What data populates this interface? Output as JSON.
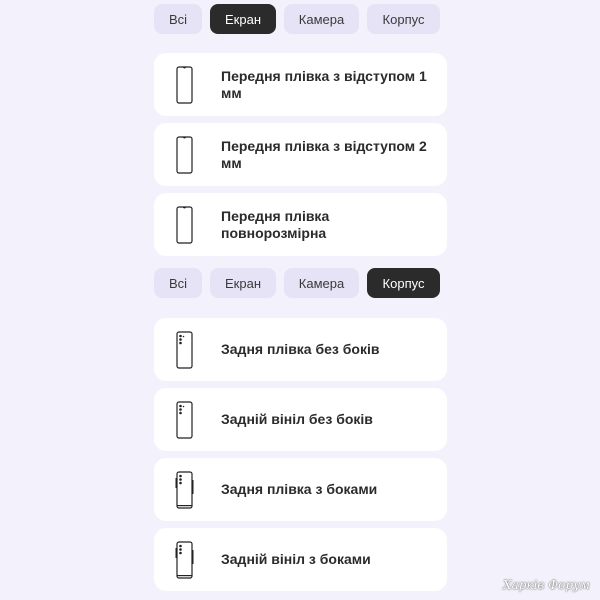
{
  "tabs_top": [
    {
      "label": "Всі",
      "active": false
    },
    {
      "label": "Екран",
      "active": true
    },
    {
      "label": "Камера",
      "active": false
    },
    {
      "label": "Корпус",
      "active": false
    }
  ],
  "screen_options": [
    {
      "label": "Передня плівка з відступом 1 мм",
      "icon": "phone-front-notch-icon"
    },
    {
      "label": "Передня плівка з відступом 2 мм",
      "icon": "phone-front-notch-icon"
    },
    {
      "label": "Передня плівка повнорозмірна",
      "icon": "phone-front-notch-icon"
    }
  ],
  "tabs_bottom": [
    {
      "label": "Всі",
      "active": false
    },
    {
      "label": "Екран",
      "active": false
    },
    {
      "label": "Камера",
      "active": false
    },
    {
      "label": "Корпус",
      "active": true
    }
  ],
  "body_options": [
    {
      "label": "Задня плівка без боків",
      "icon": "phone-back-camera-icon"
    },
    {
      "label": "Задній вініл без боків",
      "icon": "phone-back-camera-icon"
    },
    {
      "label": "Задня плівка з боками",
      "icon": "phone-back-sides-icon"
    },
    {
      "label": "Задній вініл з боками",
      "icon": "phone-back-sides-icon"
    }
  ],
  "watermark": "Харків Форум",
  "colors": {
    "background": "#f3f1fb",
    "tab": "#e7e3f6",
    "tab_active": "#2b2b2b",
    "card": "#ffffff"
  }
}
